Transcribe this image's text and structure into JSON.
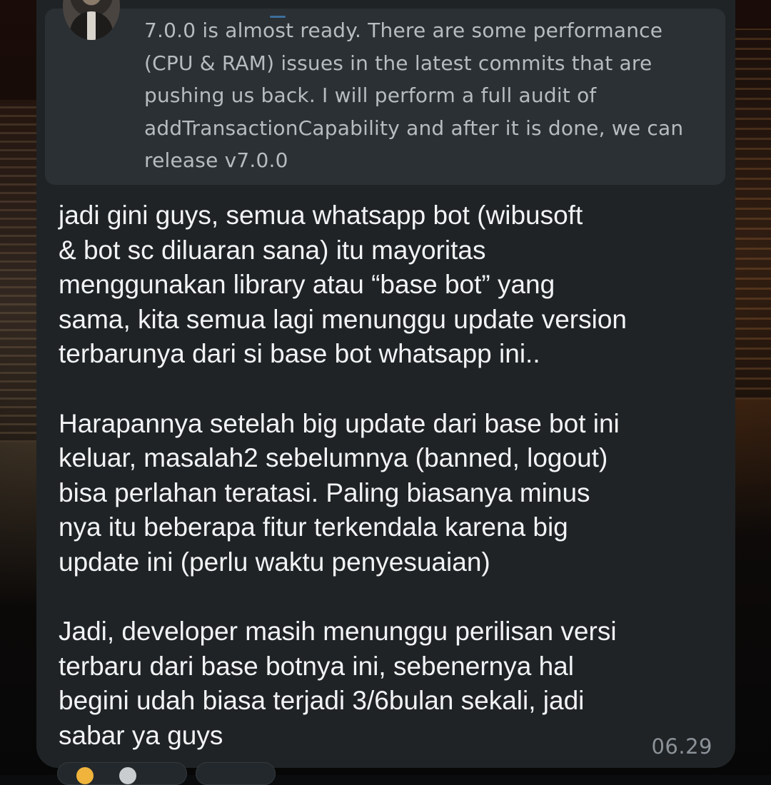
{
  "quoted_message": {
    "text": "7.0.0 is almost ready. There are some performance\n(CPU & RAM) issues in the latest commits that are\npushing us back. I will perform a full audit of\naddTransactionCapability and after it is done, we can\nrelease v7.0.0"
  },
  "message": {
    "text": "jadi gini guys, semua whatsapp bot (wibusoft\n& bot sc diluaran sana) itu mayoritas\nmenggunakan library atau “base bot” yang\nsama, kita semua lagi menunggu update version\nterbarunya dari si base bot whatsapp ini..\n\nHarapannya setelah big update dari base bot ini\nkeluar, masalah2 sebelumnya (banned, logout)\nbisa perlahan teratasi. Paling biasanya minus\nnya itu beberapa fitur terkendala karena big\nupdate ini (perlu waktu penyesuaian)\n\nJadi, developer masih menunggu perilisan versi\nterbaru dari base botnya ini, sebenernya hal\nbegini udah biasa terjadi 3/6bulan sekali, jadi\nsabar ya guys",
    "time": "06.29"
  },
  "icons": {
    "avatar": "profile-avatar",
    "reaction_1": "emoji-reaction",
    "reaction_2": "emoji-reaction"
  },
  "colors": {
    "bubble": "#1f2326",
    "quote_box": "#2b3034",
    "text_primary": "#f2f3f4",
    "text_quote": "#b7bcc0",
    "timestamp": "#8b9298"
  }
}
